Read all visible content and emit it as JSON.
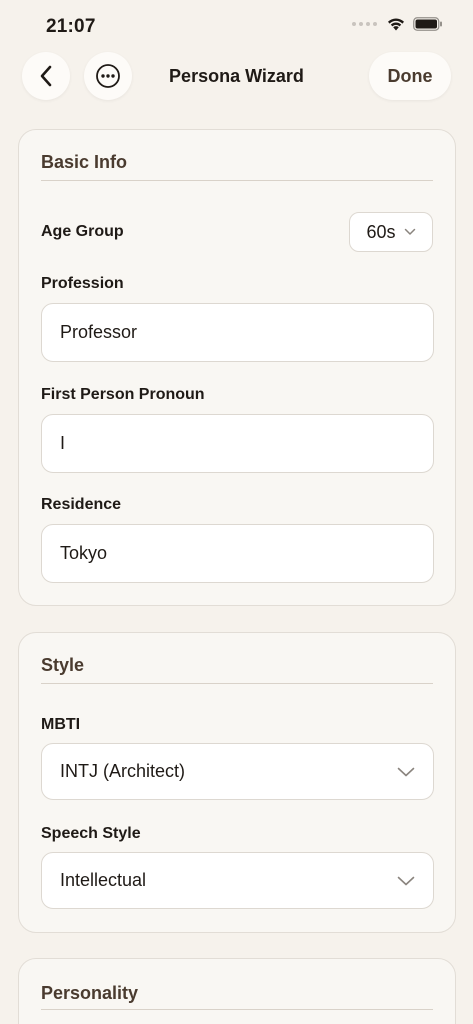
{
  "status_bar": {
    "time": "21:07"
  },
  "nav": {
    "title": "Persona Wizard",
    "done_label": "Done",
    "back_icon": "chevron-left-icon",
    "more_icon": "ellipsis-circle-icon"
  },
  "basic_info": {
    "title": "Basic Info",
    "age_group": {
      "label": "Age Group",
      "value": "60s"
    },
    "profession": {
      "label": "Profession",
      "value": "Professor"
    },
    "pronoun": {
      "label": "First Person Pronoun",
      "value": "I"
    },
    "residence": {
      "label": "Residence",
      "value": "Tokyo"
    }
  },
  "style": {
    "title": "Style",
    "mbti": {
      "label": "MBTI",
      "value": "INTJ (Architect)"
    },
    "speech_style": {
      "label": "Speech Style",
      "value": "Intellectual"
    }
  },
  "personality": {
    "title": "Personality"
  },
  "colors": {
    "background": "#f6f2ec",
    "card": "#f9f7f3",
    "section_title": "#4a3b2f",
    "border": "#ddd8d1"
  }
}
